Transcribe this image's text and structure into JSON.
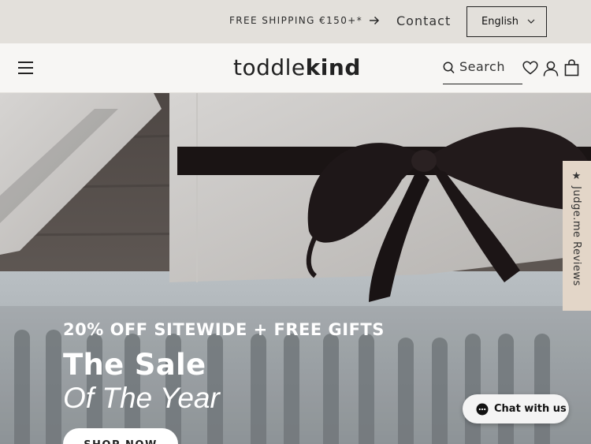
{
  "announcement": {
    "shipping_text": "FREE SHIPPING €150+*",
    "contact_label": "Contact",
    "language_selected": "English"
  },
  "header": {
    "logo_light": "toddle",
    "logo_bold": "kind",
    "search_label": "Search"
  },
  "hero": {
    "promo_line": "20% OFF SITEWIDE + FREE GIFTS",
    "headline_line1": "The Sale",
    "headline_line2": "Of The Year",
    "cta_label": "SHOP NOW"
  },
  "reviews_tab": {
    "label": "★ Judge.me Reviews"
  },
  "chat": {
    "label": "Chat with us"
  },
  "colors": {
    "topbar_bg": "#e3e0db",
    "header_bg": "#f7f6f4",
    "reviews_tab_bg": "#e3d6c8",
    "text_dark": "#222222"
  },
  "icons": [
    "arrow-right-icon",
    "chevron-down-icon",
    "menu-icon",
    "search-icon",
    "heart-icon",
    "account-icon",
    "cart-icon",
    "chat-bubble-icon"
  ]
}
